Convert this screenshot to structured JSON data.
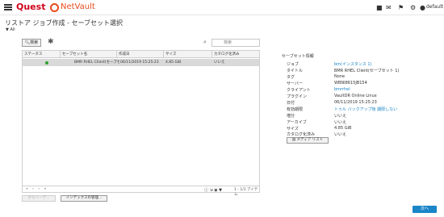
{
  "header": {
    "brand": "Quest",
    "product": "NetVault",
    "user": "default",
    "icons": [
      "video-icon",
      "chat-icon",
      "notification-icon",
      "settings-icon",
      "info-icon",
      "user-icon"
    ]
  },
  "page": {
    "title": "リストア ジョブ作成 - セーブセット選択",
    "filter_label": "All"
  },
  "toolbar": {
    "search_button": "検索",
    "search_placeholder": "検索"
  },
  "table": {
    "columns": [
      "ステータス",
      "セーブセット名",
      "作成日",
      "サイズ",
      "カタログ化済み"
    ],
    "rows": [
      {
        "status": "ok",
        "name": "BMR RHEL Client(セーブセ...",
        "created": "06/11/2019 15:25:23",
        "size": "4.85 GiB",
        "catalogued": "いいえ"
      }
    ],
    "pager": "« ‹ › »",
    "count": "1 - 1/1 アイテム"
  },
  "bottom_buttons": {
    "from": "からリーデ...",
    "index": "インデックスの管理..."
  },
  "details": {
    "title": "セーブセット情報",
    "fields": [
      {
        "label": "ジョブ",
        "value": "bm(インスタンス 1)",
        "link": true
      },
      {
        "label": "タイトル",
        "value": "BMR RHEL Client(セーブセット 1)",
        "link": false
      },
      {
        "label": "タグ",
        "value": "None",
        "link": false
      },
      {
        "label": "サーバー",
        "value": "WBNI8615JB154",
        "link": false
      },
      {
        "label": "クライアント",
        "value": "bmrrhel",
        "link": true
      },
      {
        "label": "プラグイン",
        "value": "VaultDR Online Linux",
        "link": false
      },
      {
        "label": "日付",
        "value": "06/11/2019 15:25:23",
        "link": false
      },
      {
        "label": "有効期限",
        "value": "トゥル バックアップ後 期限しない",
        "link": true
      },
      {
        "label": "増分",
        "value": "いいえ",
        "link": false
      },
      {
        "label": "アーカイブ",
        "value": "いいえ",
        "link": false
      },
      {
        "label": "サイズ",
        "value": "4.85 GiB",
        "link": false
      },
      {
        "label": "カタログ化済み",
        "value": "いいえ",
        "link": false
      }
    ],
    "media_button": "メディア リスト"
  },
  "footer": {
    "next_button": "次へ"
  },
  "colors": {
    "accent": "#1a85c7",
    "brand_red": "#d0021b",
    "netvault_orange": "#e84c1c",
    "status_ok": "#2ea12e",
    "selected_row": "#d9d9d9"
  }
}
